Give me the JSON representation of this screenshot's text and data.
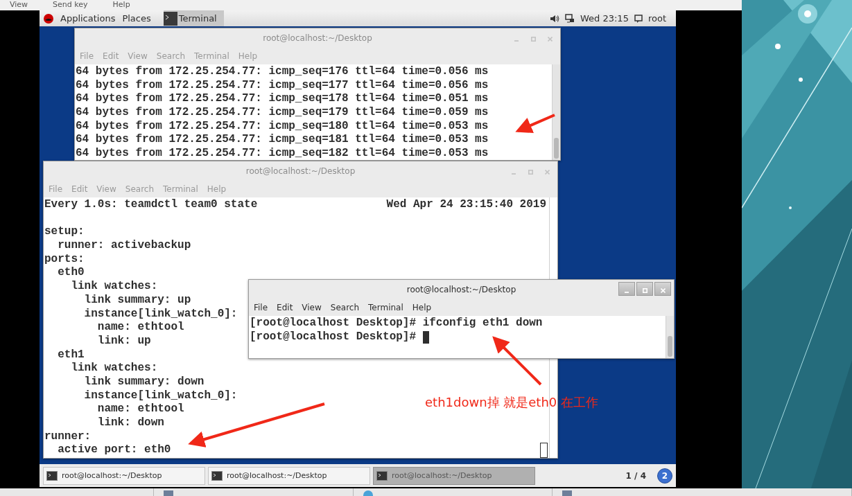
{
  "host_menu": [
    "View",
    "Send key",
    "Help"
  ],
  "top_panel": {
    "applications": "Applications",
    "places": "Places",
    "app": "Terminal",
    "clock": "Wed 23:15",
    "user": "root"
  },
  "windows": [
    {
      "title": "root@localhost:~/Desktop",
      "active": false,
      "menu": [
        "File",
        "Edit",
        "View",
        "Search",
        "Terminal",
        "Help"
      ],
      "lines": [
        "64 bytes from 172.25.254.77: icmp_seq=176 ttl=64 time=0.056 ms",
        "64 bytes from 172.25.254.77: icmp_seq=177 ttl=64 time=0.056 ms",
        "64 bytes from 172.25.254.77: icmp_seq=178 ttl=64 time=0.051 ms",
        "64 bytes from 172.25.254.77: icmp_seq=179 ttl=64 time=0.059 ms",
        "64 bytes from 172.25.254.77: icmp_seq=180 ttl=64 time=0.053 ms",
        "64 bytes from 172.25.254.77: icmp_seq=181 ttl=64 time=0.053 ms",
        "64 bytes from 172.25.254.77: icmp_seq=182 ttl=64 time=0.053 ms"
      ]
    },
    {
      "title": "root@localhost:~/Desktop",
      "active": false,
      "cursor": true,
      "menu": [
        "File",
        "Edit",
        "View",
        "Search",
        "Terminal",
        "Help"
      ],
      "header": {
        "command": "Every 1.0s: teamdctl team0 state",
        "timestamp": "Wed Apr 24 23:15:40 2019"
      },
      "lines": [
        "setup:",
        "  runner: activebackup",
        "ports:",
        "  eth0",
        "    link watches:",
        "      link summary: up",
        "      instance[link_watch_0]:",
        "        name: ethtool",
        "        link: up",
        "  eth1",
        "    link watches:",
        "      link summary: down",
        "      instance[link_watch_0]:",
        "        name: ethtool",
        "        link: down",
        "runner:",
        "  active port: eth0"
      ]
    },
    {
      "title": "root@localhost:~/Desktop",
      "active": true,
      "cursor": true,
      "menu": [
        "File",
        "Edit",
        "View",
        "Search",
        "Terminal",
        "Help"
      ],
      "lines": [
        "[root@localhost Desktop]# ifconfig eth1 down",
        "[root@localhost Desktop]#"
      ]
    }
  ],
  "annotation": "eth1down掉 就是eth0 在工作",
  "taskbar": {
    "items": [
      {
        "label": "root@localhost:~/Desktop",
        "selected": false
      },
      {
        "label": "root@localhost:~/Desktop",
        "selected": false
      },
      {
        "label": "root@localhost:~/Desktop",
        "selected": true
      }
    ],
    "pager": "1 / 4",
    "badge": "2"
  }
}
